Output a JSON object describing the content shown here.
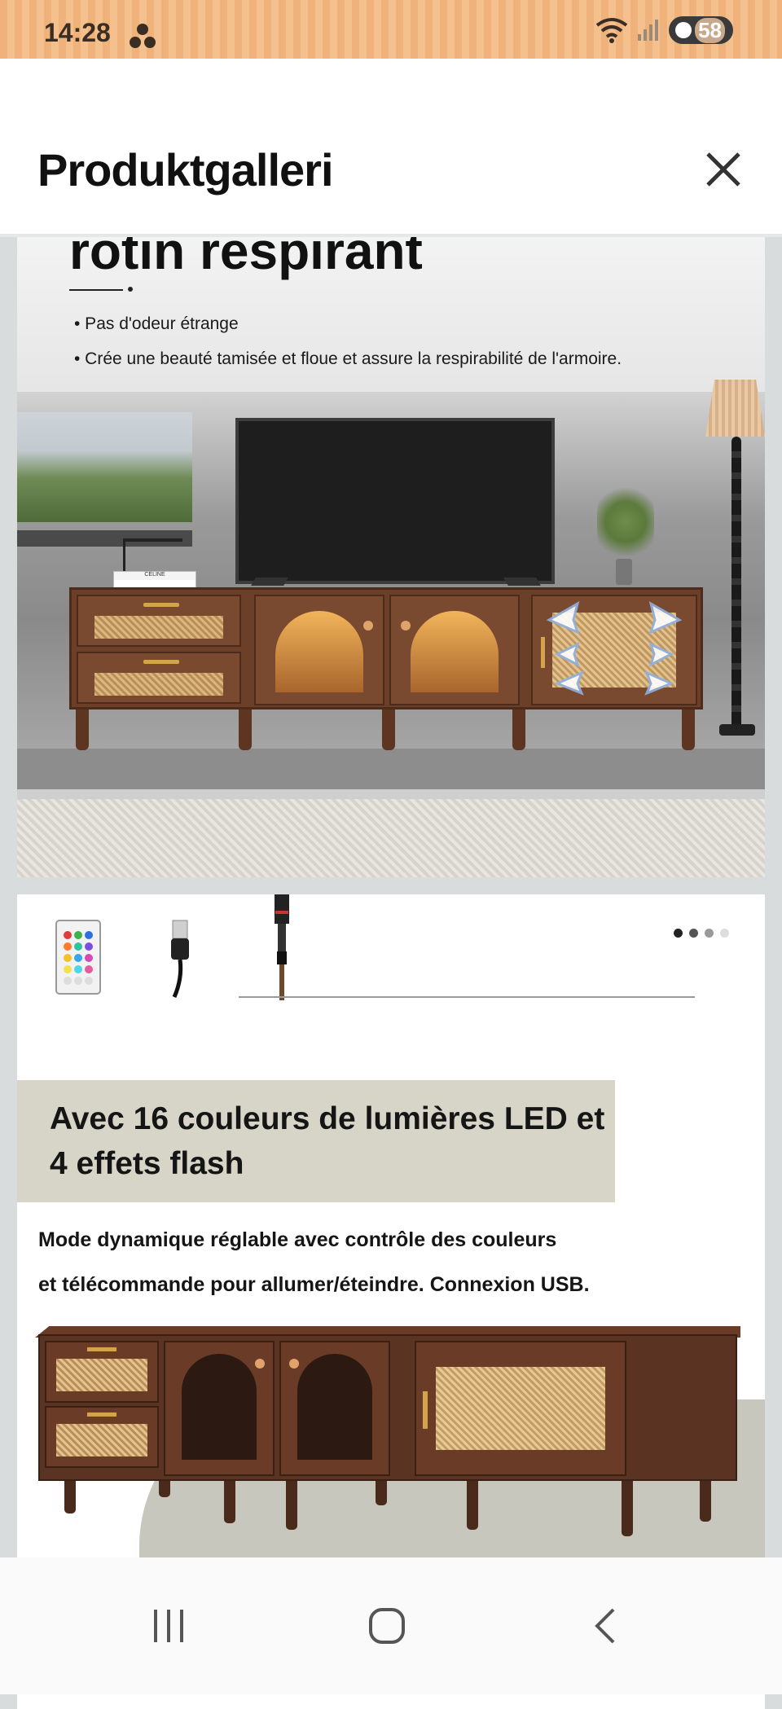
{
  "status_bar": {
    "time": "14:28",
    "battery_level": "58",
    "icons": [
      "app-notification-icon",
      "wifi-icon",
      "signal-icon",
      "battery-icon"
    ]
  },
  "header": {
    "title": "Produktgalleri",
    "close_icon": "close-icon"
  },
  "gallery": {
    "image1": {
      "heading": "rotin respirant",
      "bullets": [
        "• Pas d'odeur étrange",
        "• Crée une beauté tamisée et floue et assure la respirabilité de l'armoire."
      ],
      "book_text": "CELINE"
    },
    "image2": {
      "thumbnails": [
        "remote-control",
        "usb-cable",
        "led-controller"
      ],
      "pagination_dots": 4,
      "active_dot": 0,
      "banner_title": "Avec 16 couleurs de lumières LED et 4 effets flash",
      "description_lines": [
        "Mode dynamique réglable avec contrôle des couleurs",
        "et télécommande pour allumer/éteindre. Connexion USB."
      ]
    }
  },
  "navbar": {
    "buttons": [
      "recent-apps",
      "home",
      "back"
    ]
  },
  "colors": {
    "status_bar": "#efb27a",
    "banner": "#d6d5c8",
    "wood": "#6b3f28",
    "rattan": "#d9b77f"
  }
}
